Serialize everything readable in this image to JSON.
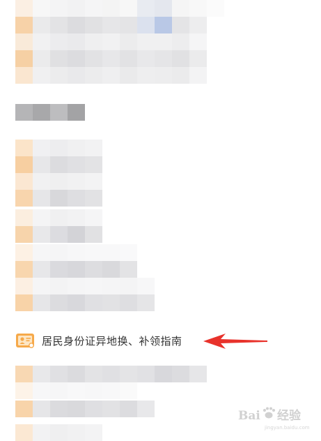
{
  "list": {
    "highlighted_item": "居民身份证异地换、补领指南"
  },
  "icons": {
    "item_icon": "id-card-icon",
    "annotation": "red-arrow-icon",
    "watermark": "baidu-jingyan-watermark"
  },
  "colors": {
    "icon_orange": "#f6a94a",
    "arrow_red": "#e8322b",
    "text": "#333333"
  },
  "watermark": {
    "brand": "Bai",
    "brand_suffix": "经验",
    "sub": "jingyan.baidu.com"
  }
}
